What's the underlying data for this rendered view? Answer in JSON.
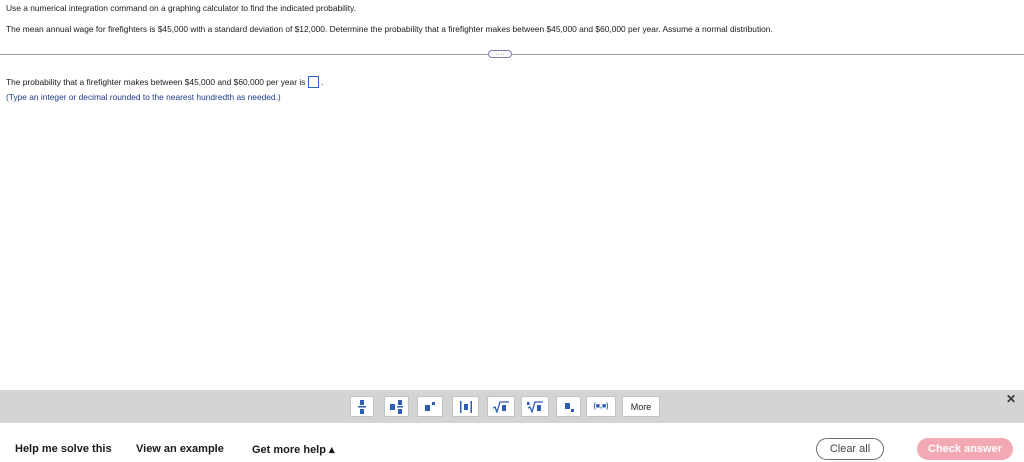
{
  "question": {
    "instruction": "Use a numerical integration command on a graphing calculator to find the indicated probability.",
    "problem": "The mean annual wage for firefighters is $45,000 with a standard deviation of $12,000. Determine the probability that a firefighter makes between $45,000 and $60,000 per year. Assume a normal distribution.",
    "ellipsis": "····",
    "answer_prompt": "The probability that a firefighter makes between $45,000 and $60,000 per year is",
    "answer_value": "",
    "answer_suffix": ".",
    "hint": "(Type an integer or decimal rounded to the nearest hundredth as needed.)"
  },
  "toolbar": {
    "buttons": [
      {
        "name": "fraction-icon"
      },
      {
        "name": "mixed-number-icon"
      },
      {
        "name": "exponent-icon"
      },
      {
        "name": "absolute-value-icon"
      },
      {
        "name": "square-root-icon"
      },
      {
        "name": "nth-root-icon"
      },
      {
        "name": "subscript-icon"
      },
      {
        "name": "ordered-pair-icon",
        "label": "(■,■)"
      }
    ],
    "more_label": "More",
    "close_label": "✕"
  },
  "footer": {
    "help_solve": "Help me solve this",
    "view_example": "View an example",
    "get_more_help": "Get more help ▴",
    "clear_all": "Clear all",
    "check_answer": "Check answer"
  }
}
